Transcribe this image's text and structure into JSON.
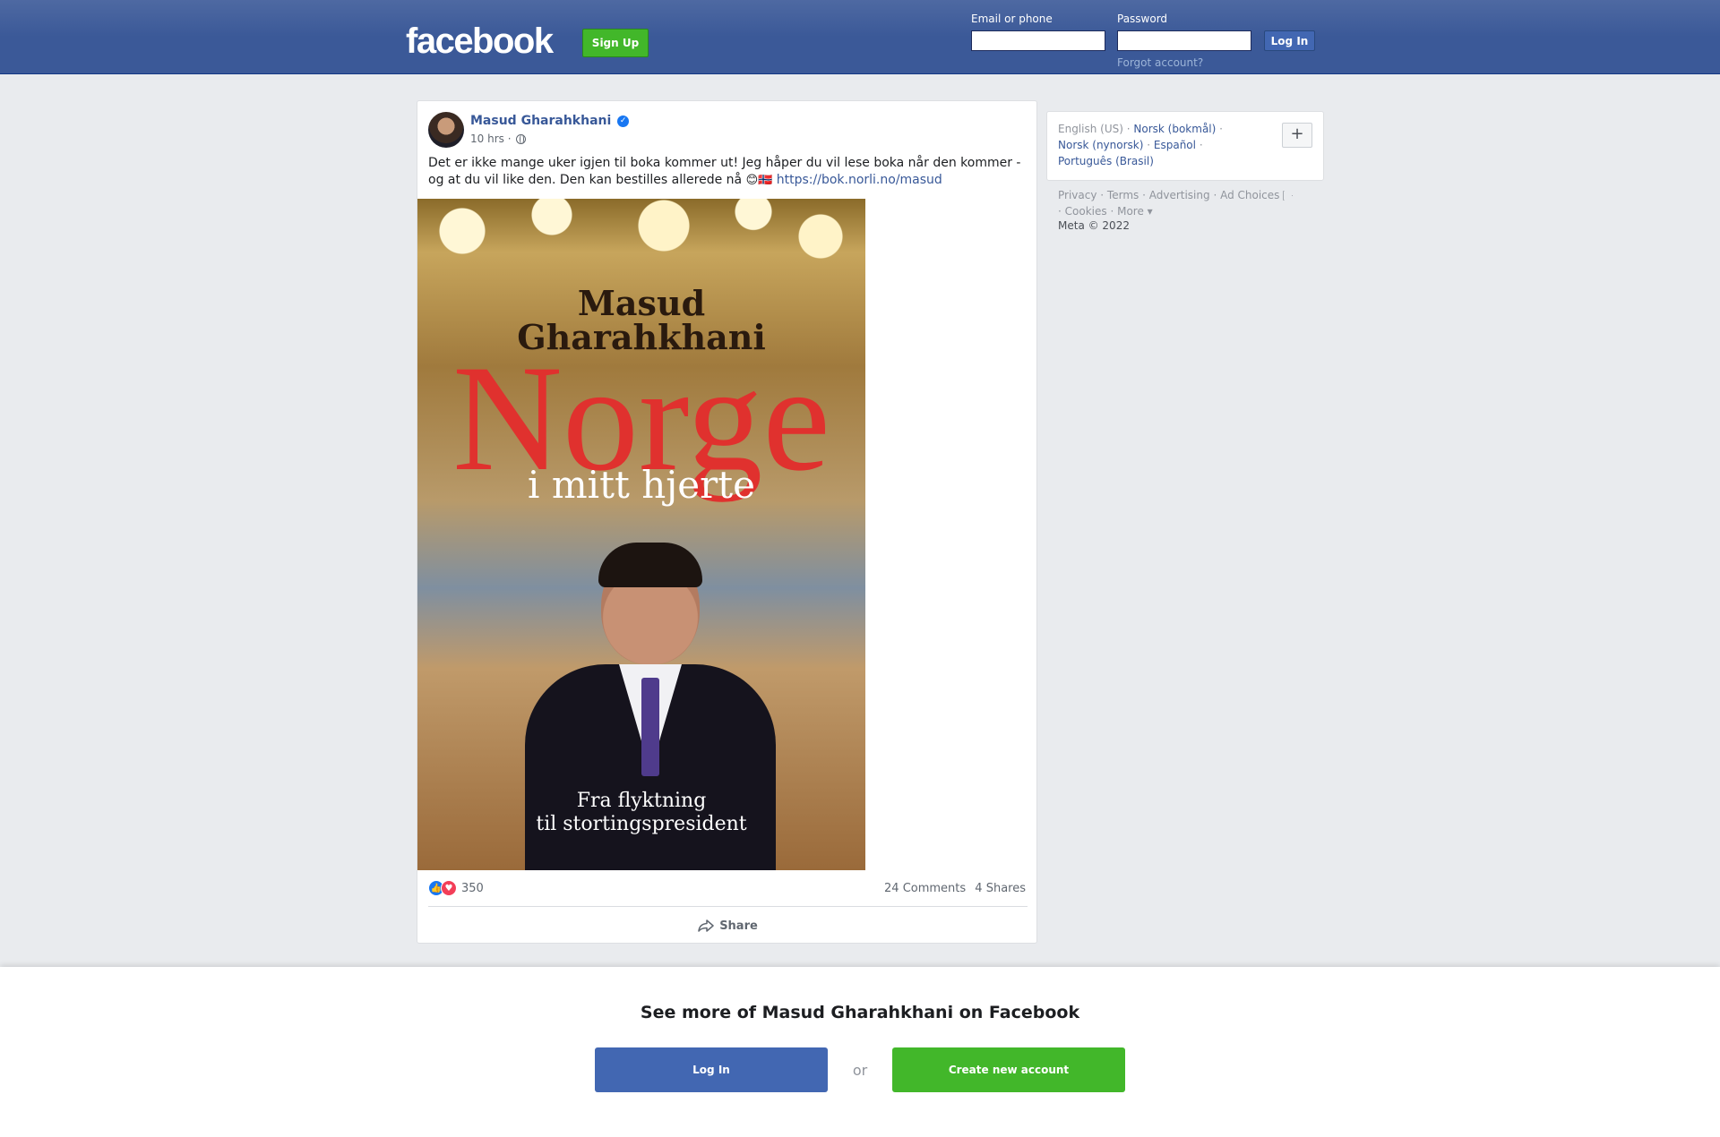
{
  "header": {
    "logo": "facebook",
    "signup_label": "Sign Up",
    "email_label": "Email or phone",
    "email_value": "",
    "password_label": "Password",
    "password_value": "",
    "login_label": "Log In",
    "forgot_label": "Forgot account?"
  },
  "post": {
    "author": "Masud Gharahkhani",
    "time": "10 hrs",
    "meta_sep": "·",
    "text": "Det er ikke mange uker igjen til boka kommer ut! Jeg håper du vil lese boka når den kommer - og at du vil like den. Den kan bestilles allerede nå",
    "emojis": "😊🇳🇴",
    "link": "https://bok.norli.no/masud",
    "cover": {
      "author_line1": "Masud",
      "author_line2": "Gharahkhani",
      "title": "Norge",
      "subtitle": "i mitt hjerte",
      "tagline_line1": "Fra flyktning",
      "tagline_line2": "til stortingspresident"
    },
    "reaction_count": "350",
    "comments": "24 Comments",
    "shares": "4 Shares",
    "share_label": "Share"
  },
  "sidebar": {
    "languages": {
      "current": "English (US)",
      "links": [
        "Norsk (bokmål)",
        "Norsk (nynorsk)",
        "Español",
        "Português (Brasil)"
      ],
      "add_label": "+"
    },
    "footer_links": [
      "Privacy",
      "Terms",
      "Advertising",
      "Ad Choices",
      "Cookies",
      "More"
    ],
    "copyright": "Meta © 2022"
  },
  "banner": {
    "title": "See more of Masud Gharahkhani on Facebook",
    "login_label": "Log In",
    "or_label": "or",
    "create_label": "Create new account"
  },
  "colors": {
    "header_blue": "#3b5998",
    "link_blue": "#385898",
    "green": "#42b72a",
    "cover_red": "#e0312e"
  }
}
